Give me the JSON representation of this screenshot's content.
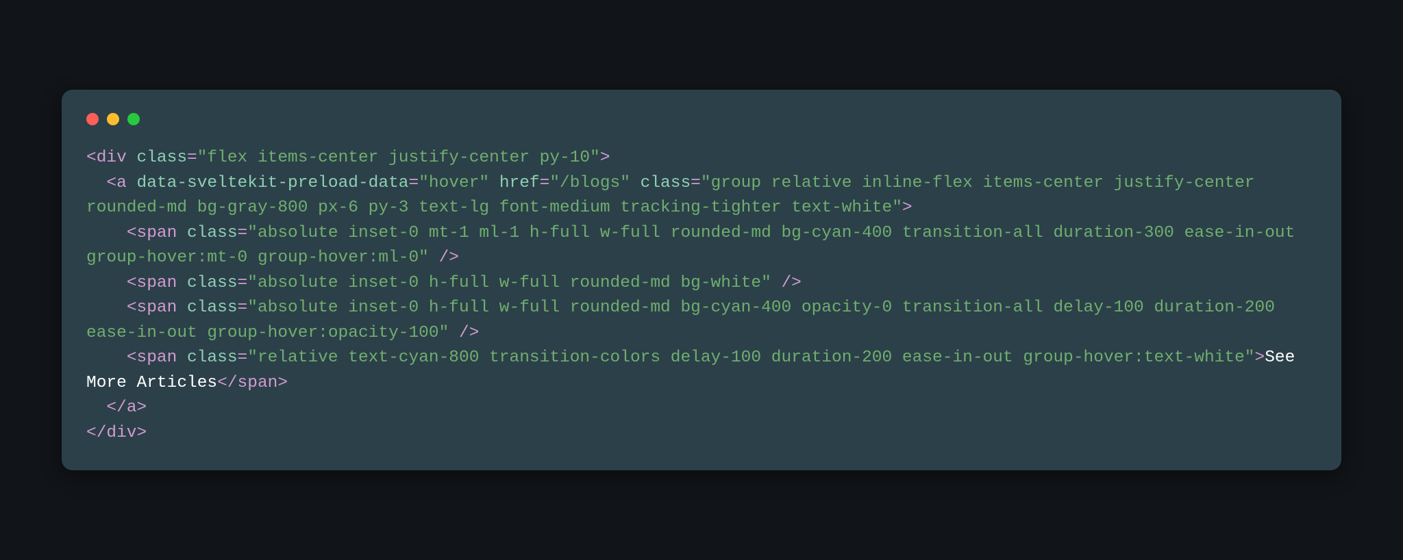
{
  "code": {
    "l1a": "<",
    "l1b": "div",
    "l1c": " ",
    "l1d": "class",
    "l1e": "=",
    "l1f": "\"flex items-center justify-center py-10\"",
    "l1g": ">",
    "l2a": "  <",
    "l2b": "a",
    "l2c": " ",
    "l2d": "data-sveltekit-preload-data",
    "l2e": "=",
    "l2f": "\"hover\"",
    "l2g": " ",
    "l2h": "href",
    "l2i": "=",
    "l2j": "\"/blogs\"",
    "l2k": " ",
    "l2l": "class",
    "l2m": "=",
    "l2n": "\"group relative inline-flex items-center justify-center rounded-md bg-gray-800 px-6 py-3 text-lg font-medium tracking-tighter text-white\"",
    "l2o": ">",
    "l3a": "    <",
    "l3b": "span",
    "l3c": " ",
    "l3d": "class",
    "l3e": "=",
    "l3f": "\"absolute inset-0 mt-1 ml-1 h-full w-full rounded-md bg-cyan-400 transition-all duration-300 ease-in-out group-hover:mt-0 group-hover:ml-0\"",
    "l3g": " />",
    "l4a": "    <",
    "l4b": "span",
    "l4c": " ",
    "l4d": "class",
    "l4e": "=",
    "l4f": "\"absolute inset-0 h-full w-full rounded-md bg-white\"",
    "l4g": " />",
    "l5a": "    <",
    "l5b": "span",
    "l5c": " ",
    "l5d": "class",
    "l5e": "=",
    "l5f": "\"absolute inset-0 h-full w-full rounded-md bg-cyan-400 opacity-0 transition-all delay-100 duration-200 ease-in-out group-hover:opacity-100\"",
    "l5g": " />",
    "l6a": "    <",
    "l6b": "span",
    "l6c": " ",
    "l6d": "class",
    "l6e": "=",
    "l6f": "\"relative text-cyan-800 transition-colors delay-100 duration-200 ease-in-out group-hover:text-white\"",
    "l6g": ">",
    "l6h": "See More Articles",
    "l6i": "</",
    "l6j": "span",
    "l6k": ">",
    "l7a": "  </",
    "l7b": "a",
    "l7c": ">",
    "l8a": "</",
    "l8b": "div",
    "l8c": ">"
  }
}
